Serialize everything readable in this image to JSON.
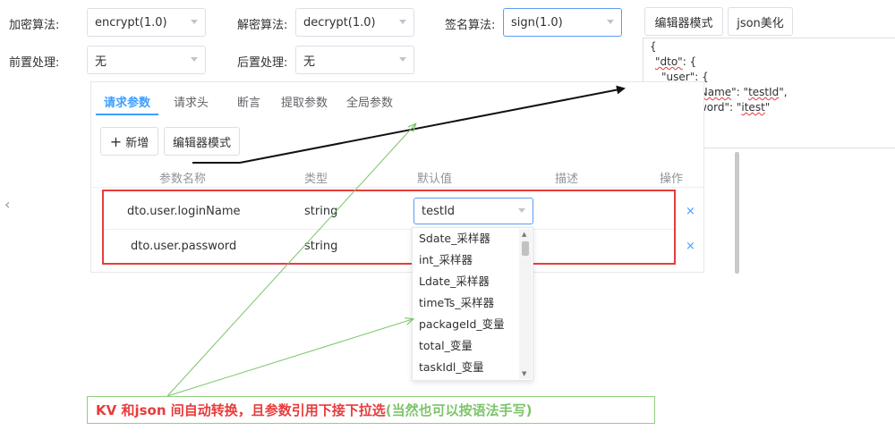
{
  "form": {
    "encrypt_label": "加密算法:",
    "encrypt_value": "encrypt(1.0)",
    "decrypt_label": "解密算法:",
    "decrypt_value": "decrypt(1.0)",
    "sign_label": "签名算法:",
    "sign_value": "sign(1.0)",
    "preprocess_label": "前置处理:",
    "preprocess_value": "无",
    "postprocess_label": "后置处理:",
    "postprocess_value": "无"
  },
  "editor_toolbar": {
    "editor_mode_label": "编辑器模式",
    "json_beautify_label": "json美化"
  },
  "json_editor": {
    "line1": "{",
    "line2_key": "\"dto\"",
    "line2_rest": ": {",
    "line3": "\"user\": {",
    "line4_prefix": "\"",
    "line4_key": "loginName",
    "line4_mid": "\": \"",
    "line4_val": "testId",
    "line4_suffix": "\",",
    "line5_prefix": "\"password\": \"",
    "line5_val": "itest",
    "line5_suffix": "\"",
    "line6": "}",
    "line7": "}"
  },
  "tabs": [
    {
      "label": "请求参数",
      "active": true
    },
    {
      "label": "请求头"
    },
    {
      "label": "断言"
    },
    {
      "label": "提取参数"
    },
    {
      "label": "全局参数"
    }
  ],
  "actions": {
    "add_icon": "+",
    "add_label": "新增",
    "editor_mode_label": "编辑器模式"
  },
  "table": {
    "headers": [
      "参数名称",
      "类型",
      "默认值",
      "描述",
      "操作"
    ],
    "rows": [
      {
        "name": "dto.user.loginName",
        "type": "string",
        "default": "testId",
        "delete": "×"
      },
      {
        "name": "dto.user.password",
        "type": "string",
        "delete": "×"
      }
    ]
  },
  "dropdown": {
    "options": [
      "Sdate_采样器",
      "int_采样器",
      "Ldate_采样器",
      "timeTs_采样器",
      "packageId_变量",
      "total_变量",
      "taskIdl_变量"
    ]
  },
  "left_arrow": "‹",
  "annotation": {
    "red_text": "KV 和json 间自动转换，且参数引用下接下拉选",
    "green_text": "(当然也可以按语法手写)"
  },
  "colors": {
    "accent": "#409eff",
    "highlight_red": "#e83b3b",
    "annotation_green": "#7cc46a",
    "annotation_border": "#8fd07f"
  }
}
